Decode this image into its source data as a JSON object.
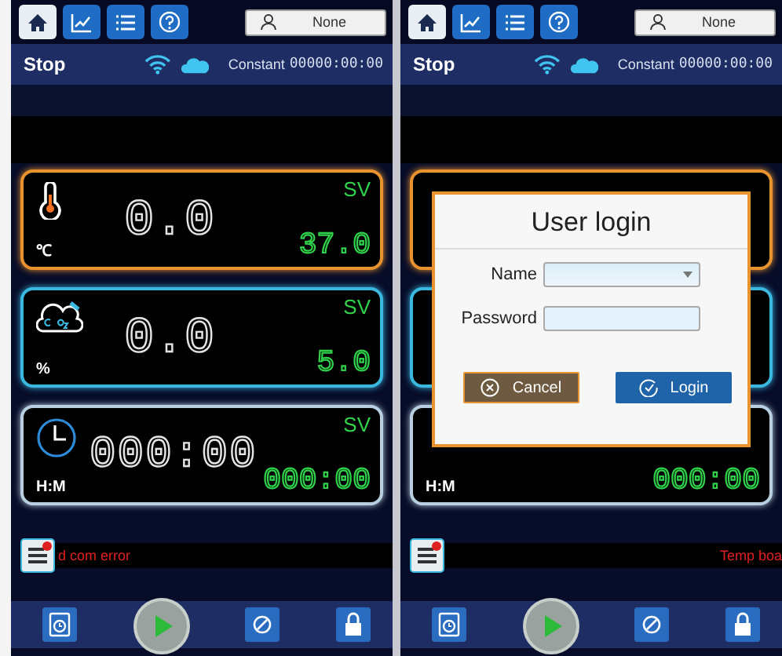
{
  "screens": [
    {
      "tabs": [
        {
          "kind": "home",
          "selected": true
        },
        {
          "kind": "chart",
          "selected": false
        },
        {
          "kind": "list",
          "selected": false
        },
        {
          "kind": "help",
          "selected": false
        }
      ],
      "user_button": "None",
      "status": "Stop",
      "mode_label": "Constant",
      "timer": "00000:00:00",
      "cards": [
        {
          "kind": "temperature",
          "color": "#e8932e",
          "value": "0.0",
          "unit": "℃",
          "sv_label": "SV",
          "setpoint": "37.0"
        },
        {
          "kind": "co2",
          "color": "#3ab8e0",
          "value": "0.0",
          "unit": "%",
          "sv_label": "SV",
          "setpoint": "5.0"
        },
        {
          "kind": "time",
          "color": "#b8cfe0",
          "value": "000:00",
          "unit": "H:M",
          "sv_label": "SV",
          "setpoint": "000:00"
        }
      ],
      "error_message": "d com error"
    },
    {
      "tabs": [
        {
          "kind": "home",
          "selected": true
        },
        {
          "kind": "chart",
          "selected": false
        },
        {
          "kind": "list",
          "selected": false
        },
        {
          "kind": "help",
          "selected": false
        }
      ],
      "user_button": "None",
      "status": "Stop",
      "mode_label": "Constant",
      "timer": "00000:00:00",
      "cards": [
        {
          "kind": "temperature",
          "color": "#e8932e"
        },
        {
          "kind": "co2",
          "color": "#3ab8e0"
        },
        {
          "kind": "time",
          "color": "#b8cfe0",
          "unit": "H:M",
          "setpoint": "000:00"
        }
      ],
      "error_message": "Temp boa",
      "dialog": {
        "title": "User login",
        "name_label": "Name",
        "password_label": "Password",
        "cancel": "Cancel",
        "login": "Login"
      }
    }
  ]
}
